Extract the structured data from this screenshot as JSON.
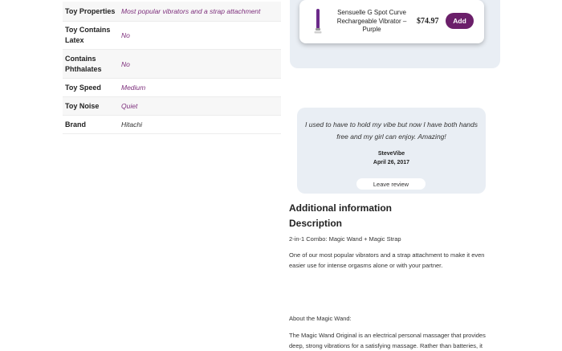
{
  "specs": [
    {
      "label": "Toy Properties",
      "value": "Most popular vibrators and a strap attachment"
    },
    {
      "label": "Toy Contains Latex",
      "value": "No"
    },
    {
      "label": "Contains Phthalates",
      "value": "No"
    },
    {
      "label": "Toy Speed",
      "value": "Medium"
    },
    {
      "label": "Toy Noise",
      "value": "Quiet"
    },
    {
      "label": "Brand",
      "value": "Hitachi"
    }
  ],
  "upsell": {
    "product_name": "Sensuelle G Spot Curve Rechargeable Vibrator – Purple",
    "price": "$74.97",
    "add_label": "Add"
  },
  "review": {
    "quote": "I used to have to hold my vibe but now I have both hands free and my girl can enjoy. Amazing!",
    "author": "SteveVibe",
    "date": "April 26, 2017",
    "leave_review_label": "Leave review"
  },
  "description": {
    "additional_info_heading": "Additional information",
    "description_heading": "Description",
    "combo_line": "2-in-1 Combo: Magic Wand + Magic Strap",
    "intro": "One of our most popular vibrators and a strap attachment to make it even easier use for intense orgasms alone or with your partner.",
    "about_heading": "About the Magic Wand:",
    "magic_wand_text": "The Magic Wand Original is an electrical personal massager that provides deep, strong vibrations for a satisfying massage. Rather than batteries, it"
  },
  "colors": {
    "accent": "#6b1f6a",
    "spec_value": "#7d2f7c",
    "panel_bg": "#e9eef4"
  }
}
